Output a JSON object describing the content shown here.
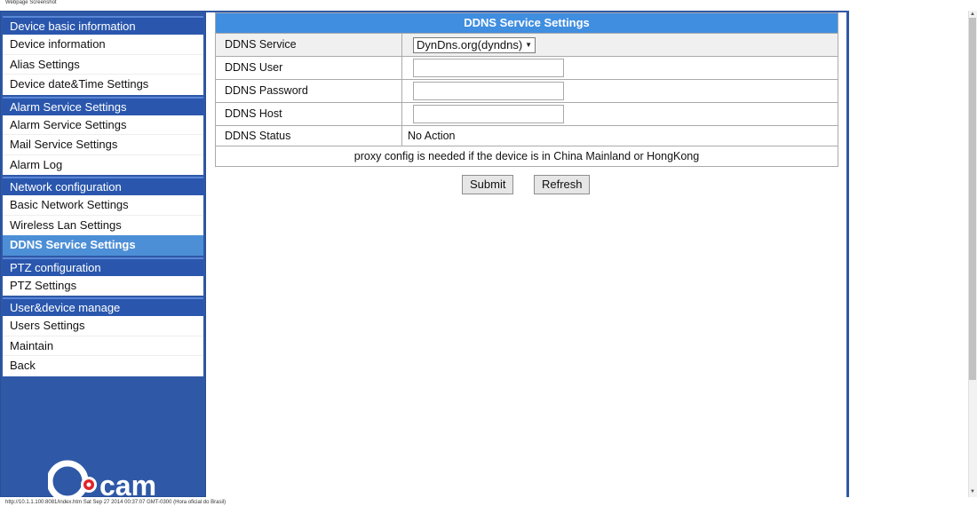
{
  "window": {
    "caption": "Webpage Screenshot"
  },
  "sidebar": {
    "sections": [
      {
        "title": "Device basic information",
        "items": [
          "Device information",
          "Alias Settings",
          "Device date&Time Settings"
        ]
      },
      {
        "title": "Alarm Service Settings",
        "items": [
          "Alarm Service Settings",
          "Mail Service Settings",
          "Alarm Log"
        ]
      },
      {
        "title": "Network configuration",
        "items": [
          "Basic Network Settings",
          "Wireless Lan Settings"
        ],
        "active_item": "DDNS Service Settings"
      },
      {
        "title": "PTZ configuration",
        "items": [
          "PTZ Settings"
        ]
      },
      {
        "title": "User&device manage",
        "items": [
          "Users Settings",
          "Maintain",
          "Back"
        ]
      }
    ],
    "logo_text": "cam"
  },
  "ddns": {
    "title": "DDNS Service Settings",
    "service_label": "DDNS Service",
    "service_value": "DynDns.org(dyndns)",
    "user_label": "DDNS User",
    "user_value": "",
    "password_label": "DDNS Password",
    "password_value": "",
    "host_label": "DDNS Host",
    "host_value": "",
    "status_label": "DDNS Status",
    "status_value": "No Action",
    "note": "proxy config is needed if the device is in China Mainland or HongKong"
  },
  "buttons": {
    "submit": "Submit",
    "refresh": "Refresh"
  },
  "status_bar": "http://10.1.1.100:8081/index.htm Sat Sep 27 2014 00:37:07 GMT-0300 (Hora oficial do Brasil)",
  "colors": {
    "sidebar_bg": "#2f58a7",
    "header_blue": "#3f8ee0",
    "active_item": "#4d8fd6",
    "logo_red": "#e0242b"
  },
  "icons": {
    "select_arrow": "chevron-down-icon",
    "scroll_up": "scroll-up-arrow-icon",
    "scroll_down": "scroll-down-arrow-icon"
  }
}
